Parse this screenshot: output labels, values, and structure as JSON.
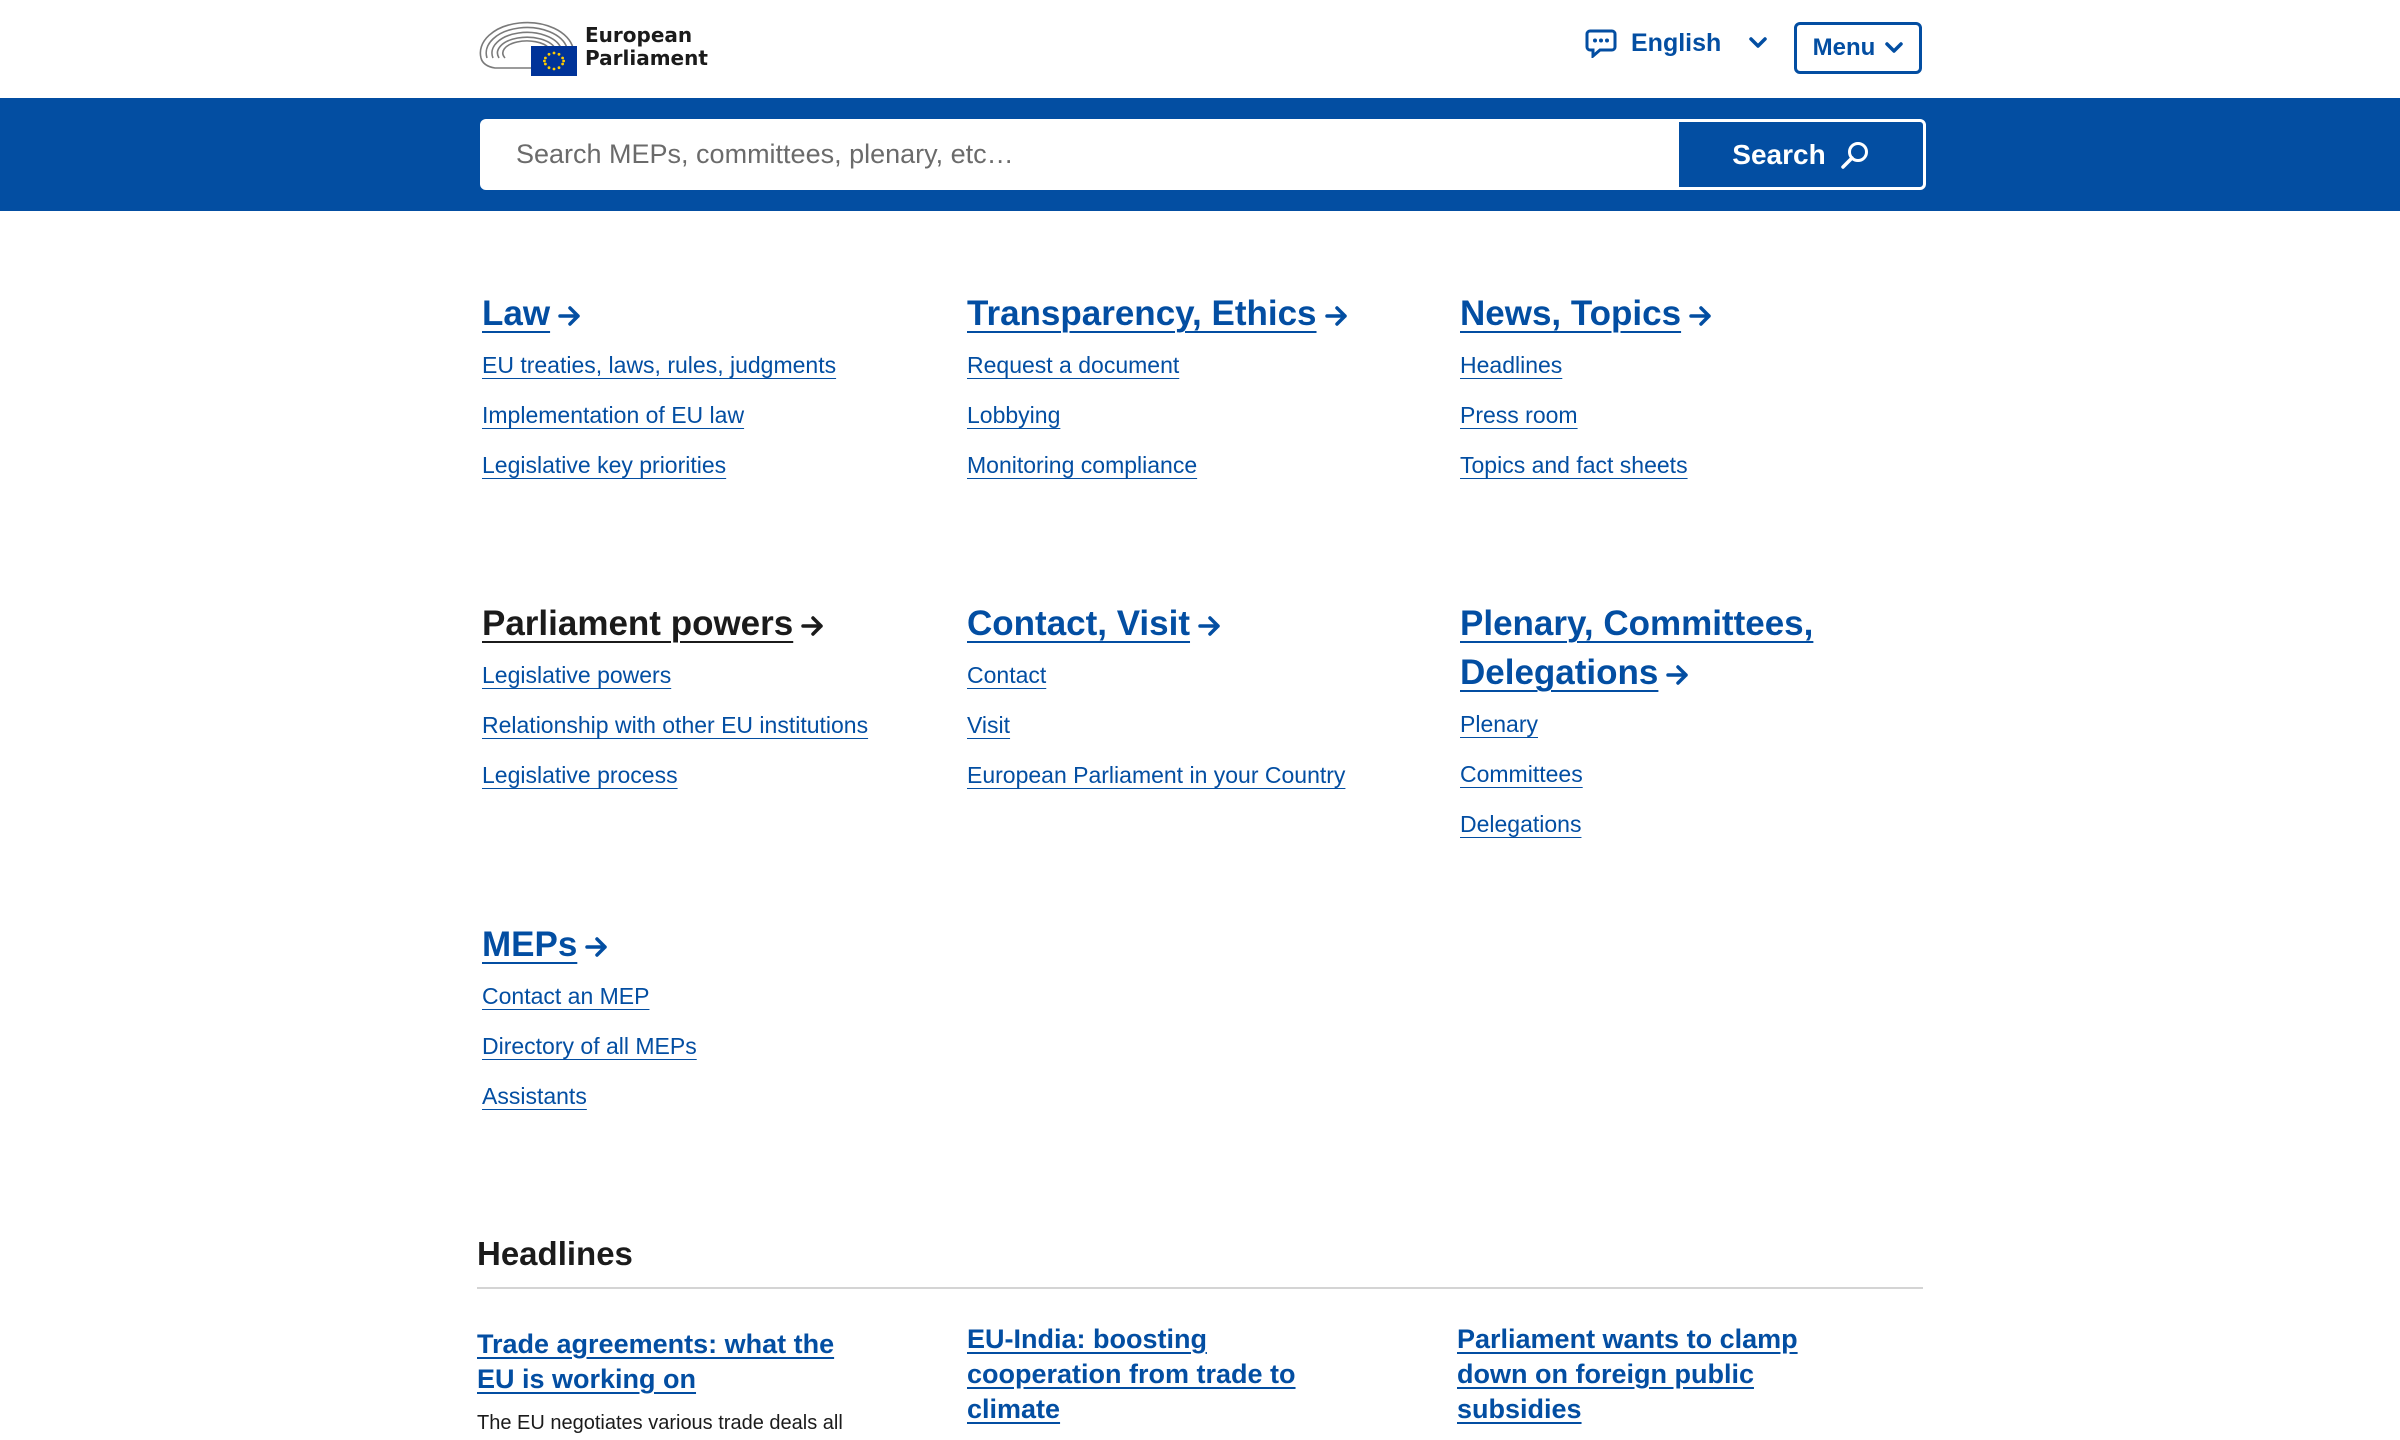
{
  "header": {
    "logo_line1": "European",
    "logo_line2": "Parliament",
    "language_label": "English",
    "menu_label": "Menu"
  },
  "search": {
    "placeholder": "Search MEPs, committees, plenary, etc…",
    "button_label": "Search"
  },
  "nav": {
    "law": {
      "title": "Law",
      "links": [
        "EU treaties, laws, rules, judgments",
        "Implementation of EU law",
        "Legislative key priorities"
      ]
    },
    "transparency": {
      "title": "Transparency, Ethics",
      "links": [
        "Request a document",
        "Lobbying",
        "Monitoring compliance"
      ]
    },
    "news": {
      "title": "News, Topics",
      "links": [
        "Headlines",
        "Press room",
        "Topics and fact sheets"
      ]
    },
    "powers": {
      "title": "Parliament powers",
      "links": [
        "Legislative powers",
        "Relationship with other EU institutions",
        "Legislative process"
      ]
    },
    "contact": {
      "title": "Contact, Visit",
      "links": [
        "Contact",
        "Visit",
        "European Parliament in your Country"
      ]
    },
    "plenary": {
      "title_line1": "Plenary, Committees,",
      "title_line2": "Delegations",
      "links": [
        "Plenary",
        "Committees",
        "Delegations"
      ]
    },
    "meps": {
      "title": "MEPs",
      "links": [
        "Contact an MEP",
        "Directory of all MEPs",
        "Assistants"
      ]
    }
  },
  "headlines": {
    "title": "Headlines",
    "items": [
      {
        "title": "Trade agreements: what the EU is working on",
        "summary": "The EU negotiates various trade deals all"
      },
      {
        "title": "EU-India: boosting cooperation from trade to climate",
        "summary": ""
      },
      {
        "title": "Parliament wants to clamp down on foreign public subsidies",
        "summary": ""
      }
    ]
  },
  "colors": {
    "brand_blue": "#034ea2",
    "text_dark": "#1b1b1b",
    "eu_flag_blue": "#003399",
    "eu_star_yellow": "#ffcc00"
  }
}
